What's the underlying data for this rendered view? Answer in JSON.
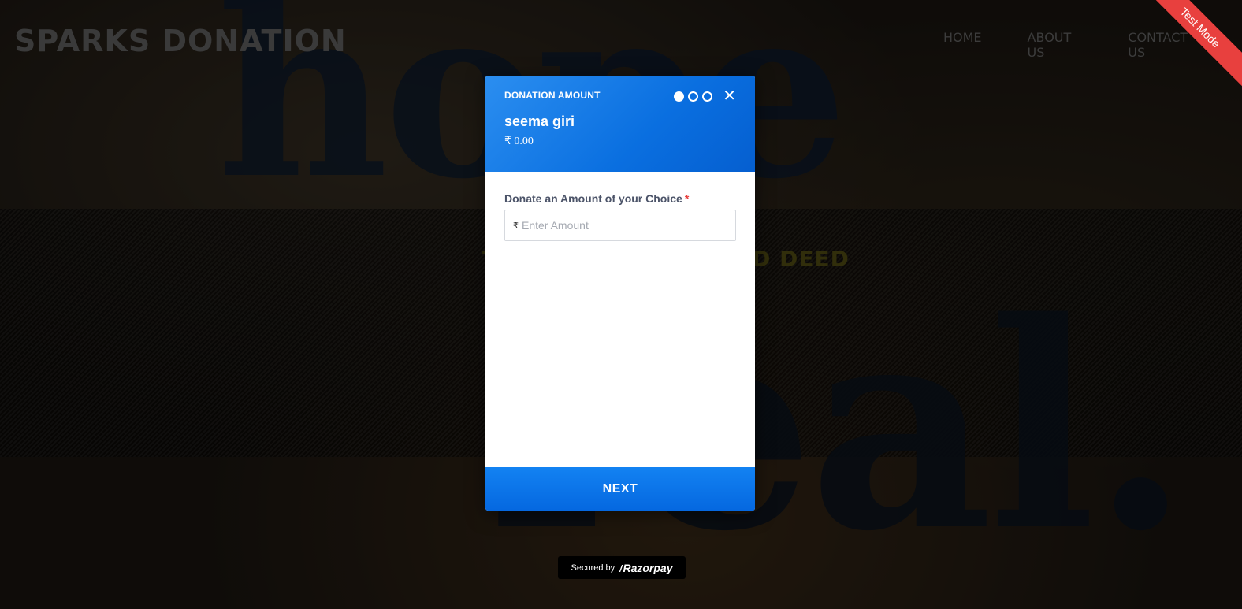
{
  "site": {
    "logo": "SPARKS DONATION",
    "nav": [
      "HOME",
      "ABOUT US",
      "CONTACT US"
    ],
    "tagline_visible_left": "T",
    "tagline_visible_right": "D DEED",
    "bg_word_1": "hope",
    "bg_word_2": "real."
  },
  "ribbon": {
    "label": "Test Mode",
    "color": "#e8403e"
  },
  "modal": {
    "section_title": "DONATION AMOUNT",
    "steps": {
      "total": 3,
      "current": 1
    },
    "close_glyph": "✕",
    "merchant_name": "seema giri",
    "amount_display": "₹ 0.00",
    "field": {
      "label": "Donate an Amount of your Choice",
      "required_mark": "*",
      "currency_glyph": "₹",
      "placeholder": "Enter Amount",
      "value": ""
    },
    "next_label": "NEXT",
    "accent": "#0a6fe0"
  },
  "footer": {
    "secured_text": "Secured by",
    "brand": "Razorpay"
  }
}
